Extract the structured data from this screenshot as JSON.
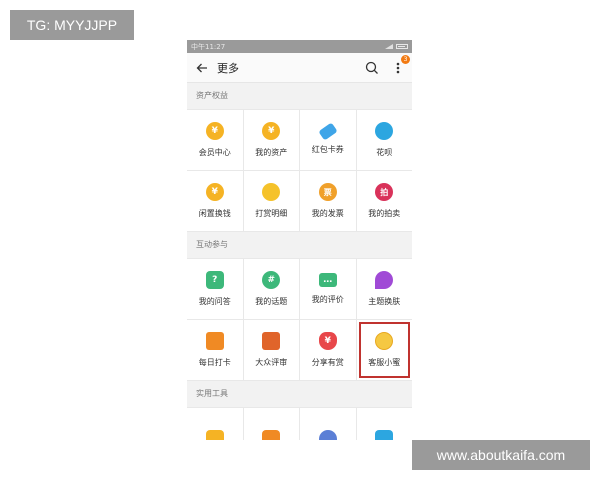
{
  "watermarks": {
    "top": "TG: MYYJJPP",
    "bottom": "www.aboutkaifa.com"
  },
  "statusbar": {
    "time": "中午11:27"
  },
  "appbar": {
    "title": "更多",
    "back_icon": "arrow-left-icon",
    "search_icon": "search-icon",
    "menu_icon": "more-vertical-icon",
    "badge": "3"
  },
  "sections": [
    {
      "header": "资产权益",
      "items": [
        {
          "label": "会员中心",
          "icon": "member-center-icon",
          "color": "#f5b324",
          "glyph": "¥"
        },
        {
          "label": "我的资产",
          "icon": "assets-icon",
          "color": "#f5b324",
          "glyph": "¥"
        },
        {
          "label": "红包卡券",
          "icon": "coupon-icon",
          "color": "#3fa5e8",
          "glyph": ""
        },
        {
          "label": "花呗",
          "icon": "huabei-icon",
          "color": "#2ca6e0",
          "glyph": ""
        },
        {
          "label": "闲置换钱",
          "icon": "idle-exchange-icon",
          "color": "#f5b324",
          "glyph": "¥"
        },
        {
          "label": "打赏明细",
          "icon": "tip-detail-icon",
          "color": "#f5c22a",
          "glyph": ""
        },
        {
          "label": "我的发票",
          "icon": "invoice-icon",
          "color": "#f0a02a",
          "glyph": "票"
        },
        {
          "label": "我的拍卖",
          "icon": "auction-icon",
          "color": "#d9325a",
          "glyph": "拍"
        }
      ]
    },
    {
      "header": "互动参与",
      "items": [
        {
          "label": "我的问答",
          "icon": "qa-icon",
          "color": "#3db87a",
          "glyph": "?"
        },
        {
          "label": "我的话题",
          "icon": "topic-icon",
          "color": "#3db87a",
          "glyph": "#"
        },
        {
          "label": "我的评价",
          "icon": "review-icon",
          "color": "#3db87a",
          "glyph": "…"
        },
        {
          "label": "主题换肤",
          "icon": "theme-icon",
          "color": "#a04ad6",
          "glyph": ""
        },
        {
          "label": "每日打卡",
          "icon": "daily-checkin-icon",
          "color": "#f08a24",
          "glyph": ""
        },
        {
          "label": "大众评审",
          "icon": "public-review-icon",
          "color": "#e0642a",
          "glyph": ""
        },
        {
          "label": "分享有赏",
          "icon": "share-reward-icon",
          "color": "#e8474a",
          "glyph": "¥"
        },
        {
          "label": "客服小蜜",
          "icon": "customer-service-icon",
          "color": "#f5c842",
          "glyph": "",
          "highlight": true
        }
      ]
    },
    {
      "header": "实用工具",
      "items": [
        {
          "label": "",
          "icon": "tool-yellow-icon",
          "color": "#f5b324"
        },
        {
          "label": "",
          "icon": "tool-orange-icon",
          "color": "#f08a24"
        },
        {
          "label": "",
          "icon": "tool-hex-icon",
          "color": "#5b7fd6"
        },
        {
          "label": "",
          "icon": "tool-blue-icon",
          "color": "#2ca6e0"
        }
      ]
    }
  ]
}
